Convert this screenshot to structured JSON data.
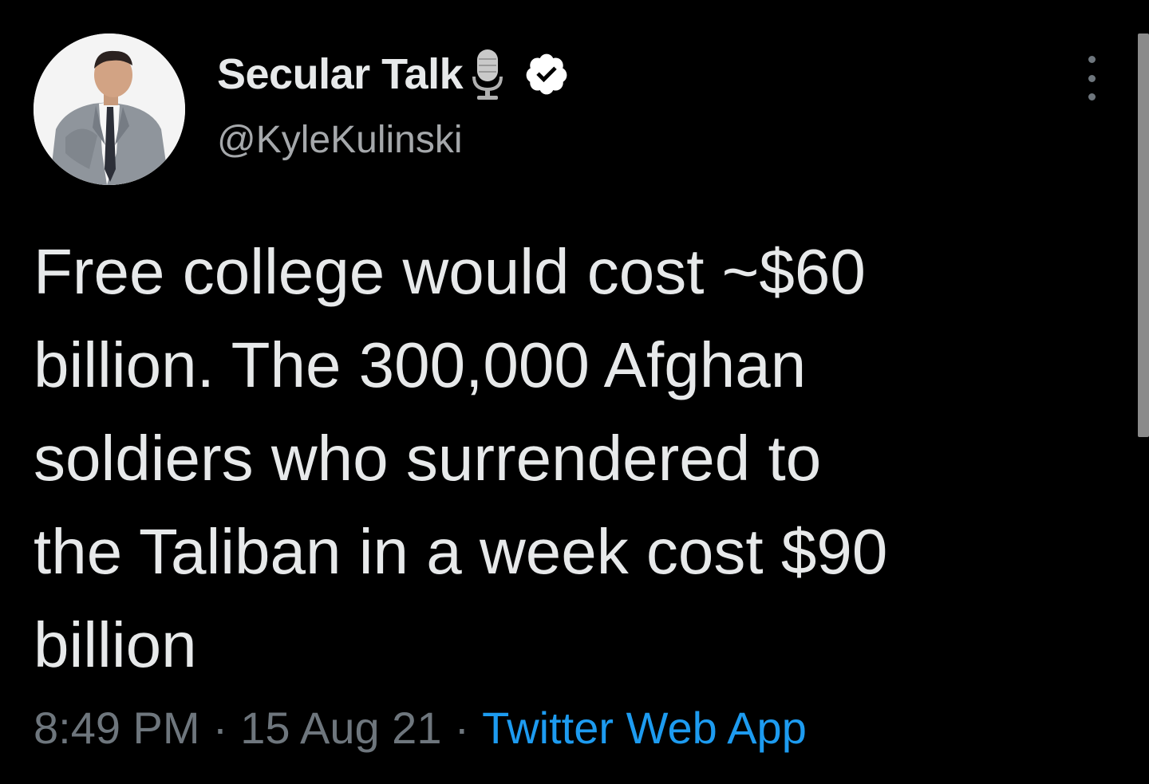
{
  "author": {
    "display_name": "Secular Talk",
    "handle": "@KyleKulinski",
    "verified": true,
    "icons": [
      "avatar",
      "microphone-icon",
      "verified-icon"
    ]
  },
  "tweet": {
    "text": "Free college would cost ~$60\nbillion. The 300,000 Afghan\nsoldiers who surrendered to\nthe Taliban in a week cost $90\nbillion",
    "time": "8:49 PM",
    "date": "15 Aug 21",
    "separator": "·",
    "source": "Twitter Web App"
  },
  "actions": {
    "more_icon": "more-vertical-icon"
  },
  "colors": {
    "background": "#000000",
    "text": "#e7e9ea",
    "secondary_text": "#6e767d",
    "link": "#1d9bf0",
    "verified_badge": "#ffffff"
  }
}
